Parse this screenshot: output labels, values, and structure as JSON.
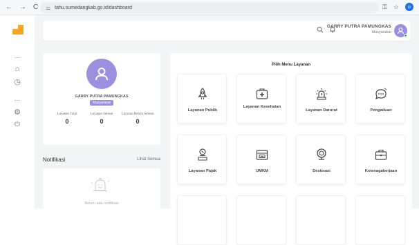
{
  "browser": {
    "back": "←",
    "forward": "→",
    "reload": "C",
    "url": "tahu.sumedangkab.go.id/dashboard",
    "key_icon": "⚿",
    "star": "☆",
    "profile_initial": "o"
  },
  "sidebar": {
    "items": [
      {
        "icon": "ellipsis-icon",
        "glyph": "…"
      },
      {
        "icon": "home-icon",
        "glyph": "⌂"
      },
      {
        "icon": "clock-icon",
        "glyph": "◷"
      },
      {
        "icon": "ellipsis-icon",
        "glyph": "…"
      },
      {
        "icon": "gear-icon",
        "glyph": "⚙"
      },
      {
        "icon": "power-icon",
        "glyph": "⏻"
      }
    ]
  },
  "header": {
    "user_name": "GARRY PUTRA PAMUNGKAS",
    "user_role": "Masyarakat"
  },
  "profile": {
    "name": "GARRY PUTRA PAMUNGKAS",
    "role": "Masyarakat",
    "stats": [
      {
        "label": "Layanan Total",
        "value": "0"
      },
      {
        "label": "Layanan Selesai",
        "value": "0"
      },
      {
        "label": "Layanan Belum Selesai",
        "value": "0"
      }
    ]
  },
  "notifications": {
    "title": "Notifikasi",
    "see_all": "Lihat Semua",
    "empty_text": "Belum ada notifikasi"
  },
  "menu": {
    "title": "Pilih Menu Layanan",
    "items": [
      {
        "label": "Layanan Publik",
        "icon": "rocket-icon"
      },
      {
        "label": "Layanan Kesehatan",
        "icon": "medical-kit-icon"
      },
      {
        "label": "Layanan Darurat",
        "icon": "siren-icon"
      },
      {
        "label": "Pengaduan",
        "icon": "chat-bubble-icon"
      },
      {
        "label": "Layanan Pajak",
        "icon": "tax-icon"
      },
      {
        "label": "UMKM",
        "icon": "store-icon"
      },
      {
        "label": "Destinasi",
        "icon": "location-pin-icon"
      },
      {
        "label": "Ketenagakerjaan",
        "icon": "briefcase-icon"
      }
    ]
  },
  "colors": {
    "accent": "#9b8fe0",
    "logo": "#f5a623",
    "background": "#f3f4f6"
  }
}
